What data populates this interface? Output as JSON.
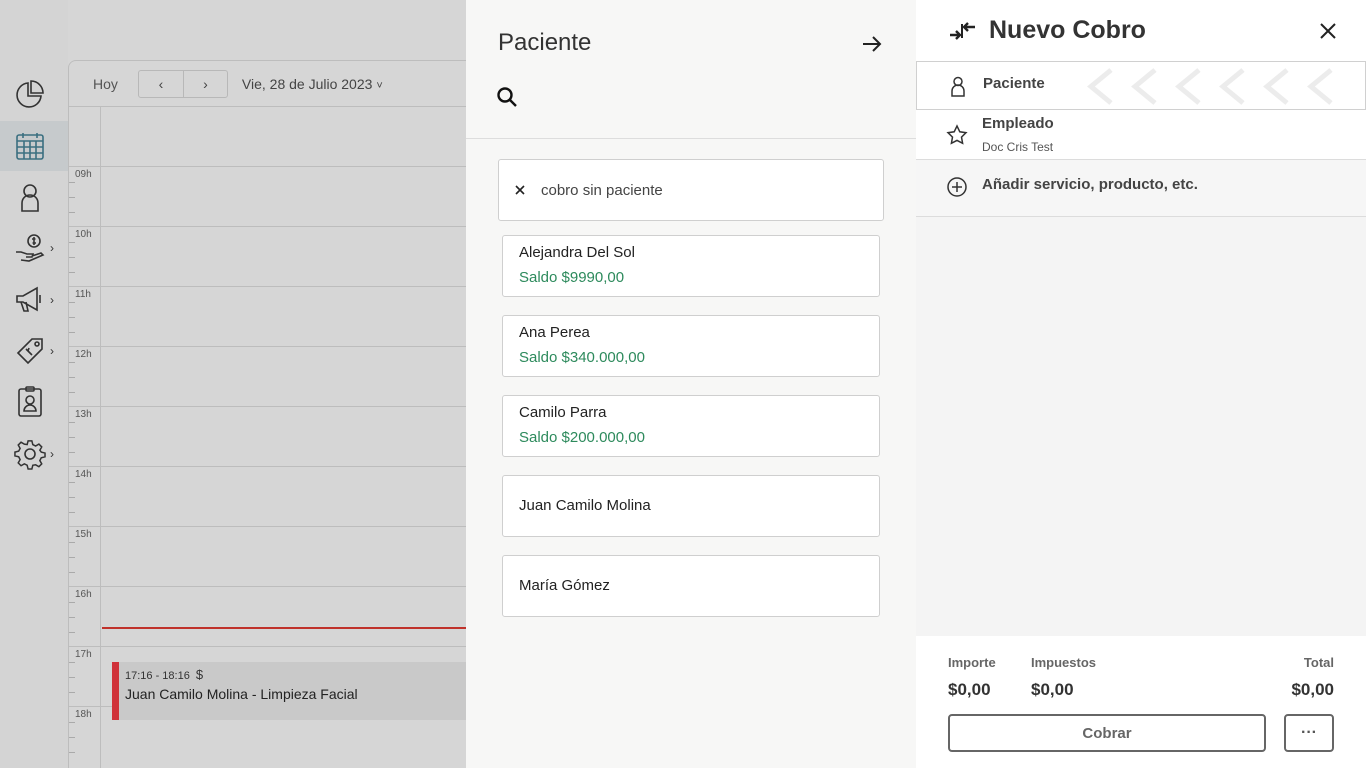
{
  "calendar": {
    "today_label": "Hoy",
    "prev_label": "‹",
    "next_label": "›",
    "date_label": "Vie, 28 de Julio 2023",
    "date_chevron": "˅",
    "hours": [
      "09h",
      "10h",
      "11h",
      "12h",
      "13h",
      "14h",
      "15h",
      "16h",
      "17h",
      "18h"
    ],
    "event": {
      "time": "17:16 - 18:16",
      "paid_icon": "$",
      "title": "Juan Camilo Molina - Limpieza Facial",
      "accent_color": "#d0323a"
    }
  },
  "sidebar": {
    "items": [
      {
        "icon": "pie-chart-icon"
      },
      {
        "icon": "calendar-icon",
        "active": true
      },
      {
        "icon": "person-icon"
      },
      {
        "icon": "money-hand-icon",
        "chevron": "›"
      },
      {
        "icon": "megaphone-icon",
        "chevron": "›"
      },
      {
        "icon": "tags-icon",
        "chevron": "›"
      },
      {
        "icon": "badge-icon"
      },
      {
        "icon": "gear-icon",
        "chevron": "›"
      }
    ]
  },
  "patient_panel": {
    "title": "Paciente",
    "chip_text": "cobro sin paciente",
    "patients": [
      {
        "name": "Alejandra Del Sol",
        "balance": "Saldo $9990,00"
      },
      {
        "name": "Ana Perea",
        "balance": "Saldo $340.000,00"
      },
      {
        "name": "Camilo Parra",
        "balance": "Saldo $200.000,00"
      },
      {
        "name": "Juan Camilo Molina",
        "balance": ""
      },
      {
        "name": "María Gómez",
        "balance": ""
      }
    ],
    "balance_color": "#2d8a5c"
  },
  "cobro": {
    "title": "Nuevo Cobro",
    "patient_label": "Paciente",
    "employee_label": "Empleado",
    "employee_value": "Doc Cris Test",
    "add_label": "Añadir servicio, producto, etc.",
    "footer": {
      "importe_label": "Importe",
      "importe_value": "$0,00",
      "impuestos_label": "Impuestos",
      "impuestos_value": "$0,00",
      "total_label": "Total",
      "total_value": "$0,00",
      "cobrar_label": "Cobrar",
      "more_label": "···"
    }
  }
}
